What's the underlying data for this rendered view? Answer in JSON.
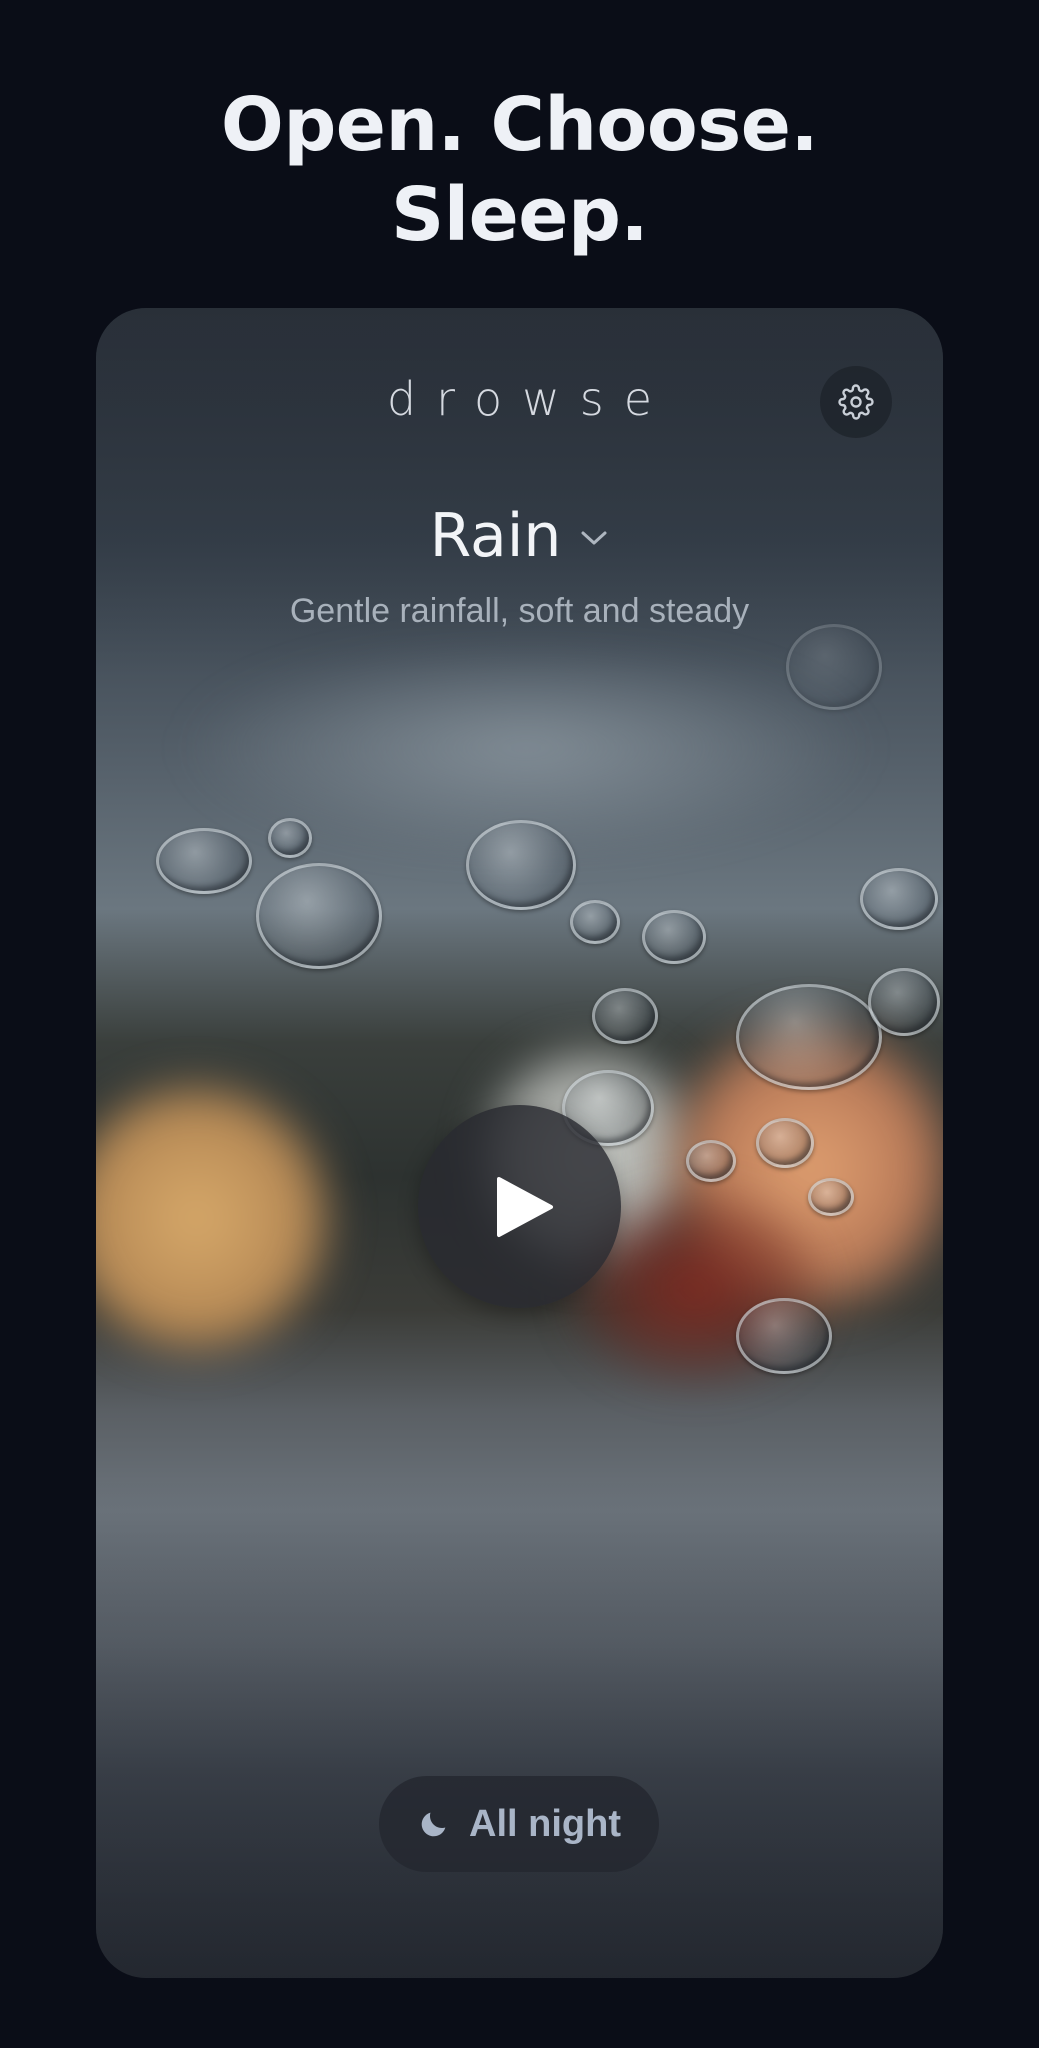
{
  "headline": {
    "line1": "Open. Choose.",
    "line2": "Sleep."
  },
  "app": {
    "name": "drowse"
  },
  "sound": {
    "title": "Rain",
    "description": "Gentle rainfall, soft and steady"
  },
  "timer": {
    "label": "All night"
  },
  "icons": {
    "settings": "gear-icon",
    "dropdown": "chevron-down-icon",
    "play": "play-icon",
    "timer": "moon-icon"
  },
  "colors": {
    "page_background": "#0a0d17",
    "headline_text": "#eef1f6",
    "timer_label": "#a9b5c7"
  }
}
